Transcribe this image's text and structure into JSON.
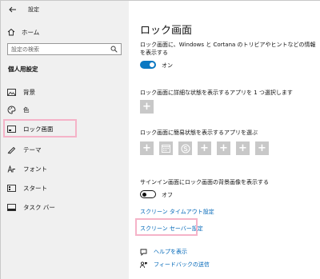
{
  "window": {
    "title": "設定"
  },
  "sidebar": {
    "home_label": "ホーム",
    "search_placeholder": "設定の検索",
    "section_title": "個人用設定",
    "items": [
      {
        "label": "背景",
        "icon": "image-icon"
      },
      {
        "label": "色",
        "icon": "palette-icon"
      },
      {
        "label": "ロック画面",
        "icon": "lock-screen-icon",
        "selected": true
      },
      {
        "label": "テーマ",
        "icon": "brush-icon"
      },
      {
        "label": "フォント",
        "icon": "font-icon"
      },
      {
        "label": "スタート",
        "icon": "start-icon"
      },
      {
        "label": "タスク バー",
        "icon": "taskbar-icon"
      }
    ]
  },
  "main": {
    "title": "ロック画面",
    "fun_facts_desc": "ロック画面に、Windows と Cortana のトリビアやヒントなどの情報を表示する",
    "fun_facts_toggle": "オン",
    "detailed_status_desc": "ロック画面に詳細な状態を表示するアプリを 1 つ選択します",
    "quick_status_desc": "ロック画面に簡易状態を表示するアプリを選ぶ",
    "quick_status_tiles": [
      "plus",
      "calendar",
      "skype",
      "plus",
      "plus",
      "plus",
      "plus"
    ],
    "signin_bg_desc": "サインイン画面にロック画面の背景画像を表示する",
    "signin_bg_toggle": "オフ",
    "screen_timeout_link": "スクリーン タイムアウト設定",
    "screensaver_link": "スクリーン セーバー設定",
    "help_label": "ヘルプを表示",
    "feedback_label": "フィードバックの送信"
  },
  "colors": {
    "accent": "#0a78c2",
    "link": "#0067b8",
    "highlight": "#f5b3c8",
    "tile": "#c8c8c8"
  }
}
